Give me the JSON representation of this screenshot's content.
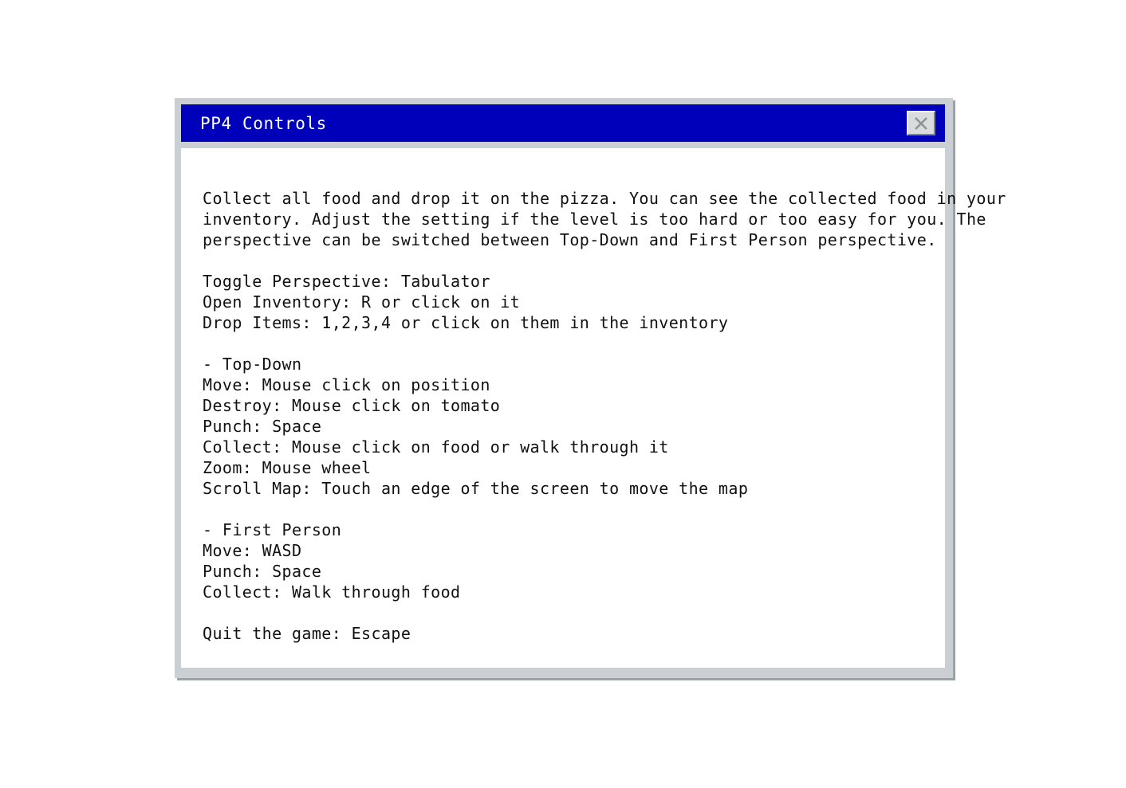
{
  "dialog": {
    "title": "PP4 Controls",
    "close_icon": "close-x-icon",
    "colors": {
      "titlebar": "#0000bb",
      "frame": "#c9cfd2",
      "content_bg": "#ffffff"
    }
  },
  "content": {
    "intro": [
      "Collect all food and drop it on the pizza. You can see the collected food in your",
      "inventory. Adjust the setting if the level is too hard or too easy for you. The",
      "perspective can be switched between Top-Down and First Person perspective."
    ],
    "general": [
      "Toggle Perspective: Tabulator",
      "Open Inventory: R or click on it",
      "Drop Items: 1,2,3,4 or click on them in the inventory"
    ],
    "top_down": [
      "- Top-Down",
      "Move: Mouse click on position",
      "Destroy: Mouse click on tomato",
      "Punch: Space",
      "Collect: Mouse click on food or walk through it",
      "Zoom: Mouse wheel",
      "Scroll Map: Touch an edge of the screen to move the map"
    ],
    "first_person": [
      "- First Person",
      "Move: WASD",
      "Punch: Space",
      "Collect: Walk through food"
    ],
    "quit": "Quit the game: Escape"
  }
}
